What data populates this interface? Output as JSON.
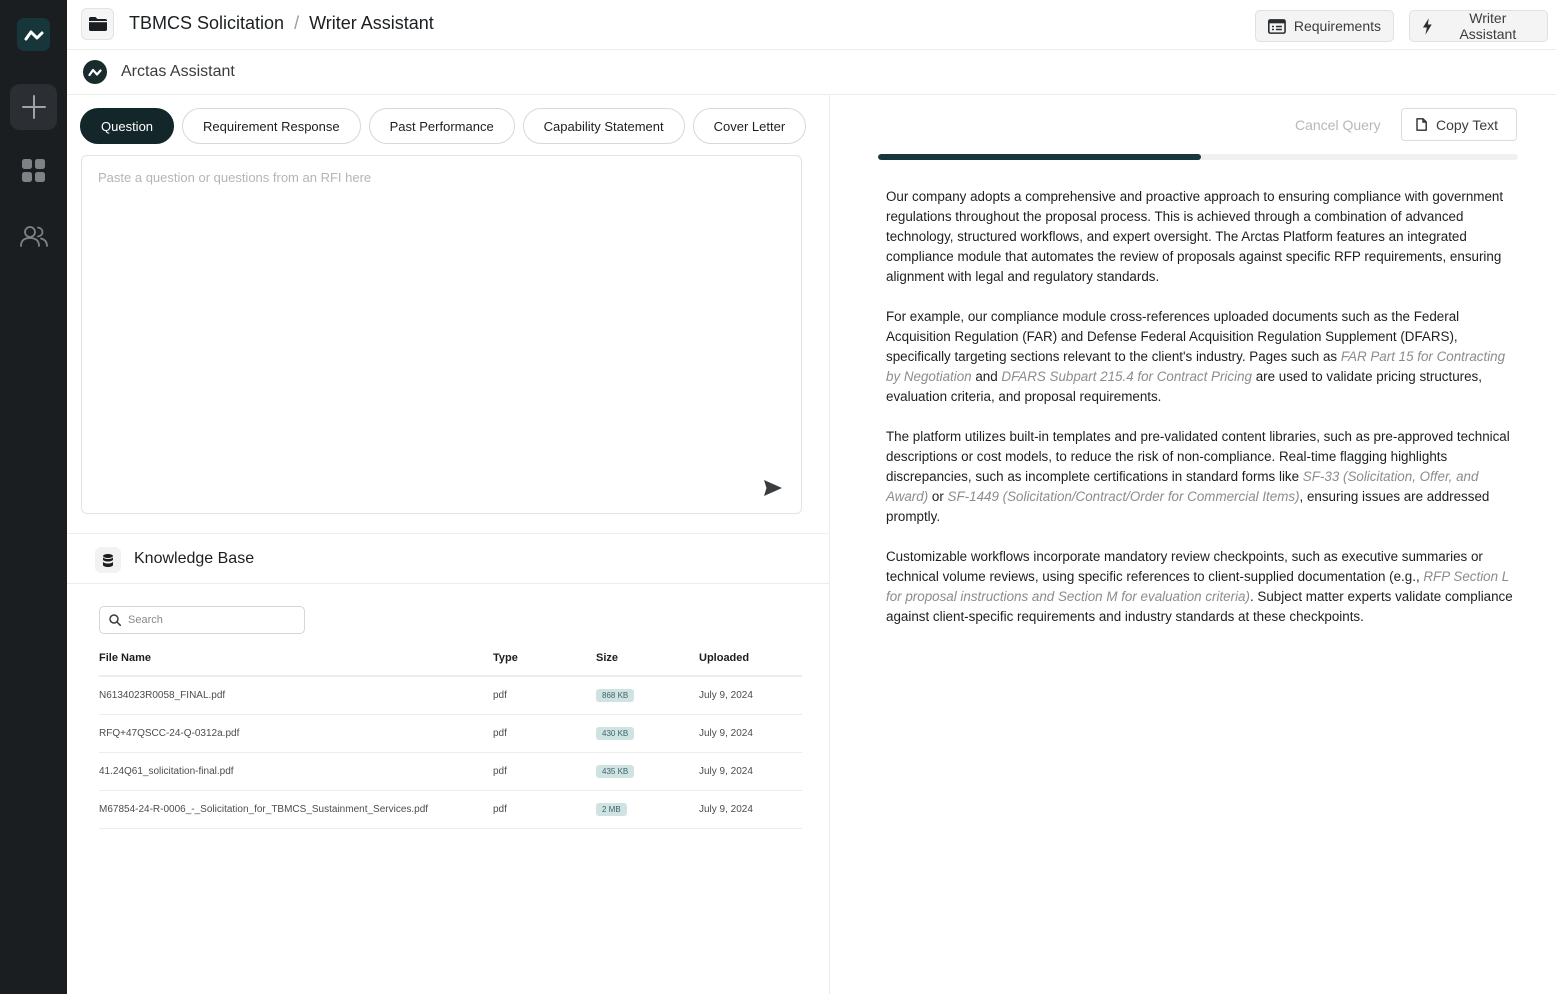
{
  "app": {
    "colors": {
      "sidebar": "#1b1e21",
      "accent": "#13272a",
      "progress": "#17373a",
      "badge": "#cfe3e3"
    }
  },
  "sidebar": {
    "items": [
      {
        "icon": "app-logo-icon"
      },
      {
        "icon": "plus-icon"
      },
      {
        "icon": "grid-icon"
      },
      {
        "icon": "users-icon"
      }
    ]
  },
  "header": {
    "breadcrumb": {
      "project": "TBMCS Solicitation",
      "separator": "/",
      "page": "Writer Assistant"
    },
    "buttons": {
      "requirements": "Requirements",
      "writer_assistant": "Writer Assistant"
    }
  },
  "assistant": {
    "title": "Arctas Assistant"
  },
  "tabs": [
    {
      "label": "Question",
      "active": true
    },
    {
      "label": "Requirement Response",
      "active": false
    },
    {
      "label": "Past Performance",
      "active": false
    },
    {
      "label": "Capability Statement",
      "active": false
    },
    {
      "label": "Cover Letter",
      "active": false
    }
  ],
  "question": {
    "placeholder": "Paste a question or questions from an RFI here",
    "value": ""
  },
  "knowledge_base": {
    "title": "Knowledge Base",
    "search_placeholder": "Search",
    "columns": {
      "name": "File Name",
      "type": "Type",
      "size": "Size",
      "uploaded": "Uploaded"
    },
    "files": [
      {
        "name": "N6134023R0058_FINAL.pdf",
        "type": "pdf",
        "size": "868 KB",
        "uploaded": "July 9, 2024"
      },
      {
        "name": "RFQ+47QSCC-24-Q-0312a.pdf",
        "type": "pdf",
        "size": "430 KB",
        "uploaded": "July 9, 2024"
      },
      {
        "name": "41.24Q61_solicitation-final.pdf",
        "type": "pdf",
        "size": "435 KB",
        "uploaded": "July 9, 2024"
      },
      {
        "name": "M67854-24-R-0006_-_Solicitation_for_TBMCS_Sustainment_Services.pdf",
        "type": "pdf",
        "size": "2 MB",
        "uploaded": "July 9, 2024"
      }
    ]
  },
  "response": {
    "cancel_label": "Cancel Query",
    "copy_label": "Copy Text",
    "progress": 0.505,
    "p1": "Our company adopts a comprehensive and proactive approach to ensuring compliance with government regulations throughout the proposal process. This is achieved through a combination of advanced technology, structured workflows, and expert oversight. The Arctas Platform features an integrated compliance module that automates the review of proposals against specific RFP requirements, ensuring alignment with legal and regulatory standards.",
    "p2_a": "For example, our compliance module cross-references uploaded documents such as the Federal Acquisition Regulation (FAR) and Defense Federal Acquisition Regulation Supplement (DFARS), specifically targeting sections relevant to the client's industry. Pages such as ",
    "p2_ref1": "FAR Part 15 for Contracting by Negotiation",
    "p2_b": " and ",
    "p2_ref2": "DFARS Subpart 215.4 for Contract Pricing",
    "p2_c": " are used to validate pricing structures, evaluation criteria, and proposal requirements.",
    "p3_a": "The platform utilizes built-in templates and pre-validated content libraries, such as pre-approved technical descriptions or cost models, to reduce the risk of non-compliance. Real-time flagging highlights discrepancies, such as incomplete certifications in standard forms like ",
    "p3_ref1": "SF-33 (Solicitation, Offer, and Award)",
    "p3_b": " or ",
    "p3_ref2": "SF-1449 (Solicitation/Contract/Order for Commercial Items)",
    "p3_c": ", ensuring issues are addressed promptly.",
    "p4_a": "Customizable workflows incorporate mandatory review checkpoints, such as executive summaries or technical volume reviews, using specific references to client-supplied documentation (e.g., ",
    "p4_ref1": "RFP Section L for proposal instructions and Section M for evaluation criteria)",
    "p4_b": ". Subject matter experts validate compliance against client-specific requirements and industry standards at these checkpoints."
  }
}
